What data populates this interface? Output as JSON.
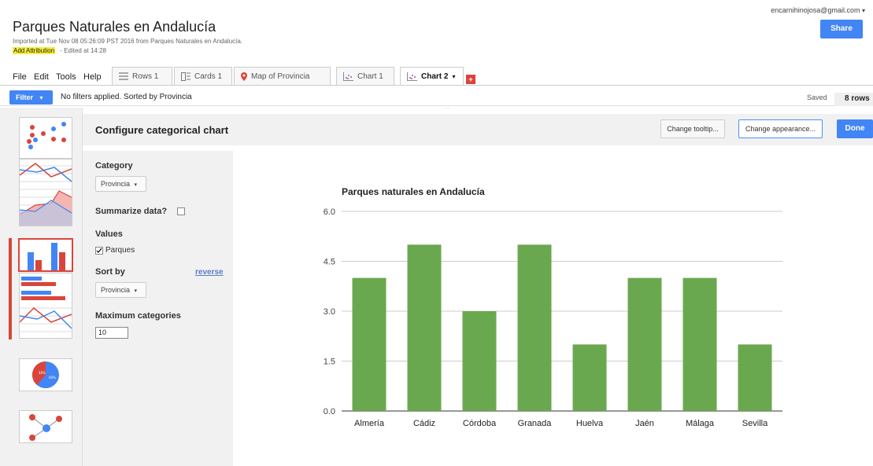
{
  "header": {
    "title": "Parques Naturales en Andalucía",
    "imported": "Imported at Tue Nov 08 05:26:09 PST 2016 from Parques Naturales en Andalucía.",
    "add_attribution": "Add Attribution",
    "edited": "-  Edited at 14:28",
    "account": "encarnihinojosa@gmail.com",
    "share_label": "Share"
  },
  "menu": [
    "File",
    "Edit",
    "Tools",
    "Help"
  ],
  "tabs": [
    {
      "label": "Rows 1",
      "icon": "rows-icon"
    },
    {
      "label": "Cards 1",
      "icon": "cards-icon"
    },
    {
      "label": "Map of Provincia",
      "icon": "map-pin-icon"
    },
    {
      "label": "Chart 1",
      "icon": "scatter-chart-icon"
    },
    {
      "label": "Chart 2",
      "icon": "scatter-chart-icon",
      "active": true
    }
  ],
  "add_tab_label": "+",
  "filterbar": {
    "filter_label": "Filter",
    "status": "No filters applied. Sorted by Provincia",
    "saved": "Saved",
    "rows": "8 rows"
  },
  "config": {
    "title": "Configure categorical chart",
    "change_tooltip": "Change tooltip...",
    "change_appearance": "Change appearance...",
    "done": "Done",
    "category_label": "Category",
    "category_value": "Provincia",
    "summarize_label": "Summarize data?",
    "values_label": "Values",
    "values_item": "Parques",
    "sortby_label": "Sort by",
    "reverse_label": "reverse",
    "sortby_value": "Provincia",
    "maxcat_label": "Maximum categories",
    "maxcat_value": "10"
  },
  "colors": {
    "accent": "#4285f4",
    "bar": "#6aa84f",
    "red": "#d9453b"
  },
  "chart_data": {
    "type": "bar",
    "title": "Parques naturales en Andalucía",
    "categories": [
      "Almería",
      "Cádiz",
      "Córdoba",
      "Granada",
      "Huelva",
      "Jaén",
      "Málaga",
      "Sevilla"
    ],
    "values": [
      4,
      5,
      3,
      5,
      2,
      4,
      4,
      2
    ],
    "yticks": [
      "0.0",
      "1.5",
      "3.0",
      "4.5",
      "6.0"
    ],
    "ylim": [
      0,
      6
    ],
    "grid": true,
    "legend": "none"
  }
}
